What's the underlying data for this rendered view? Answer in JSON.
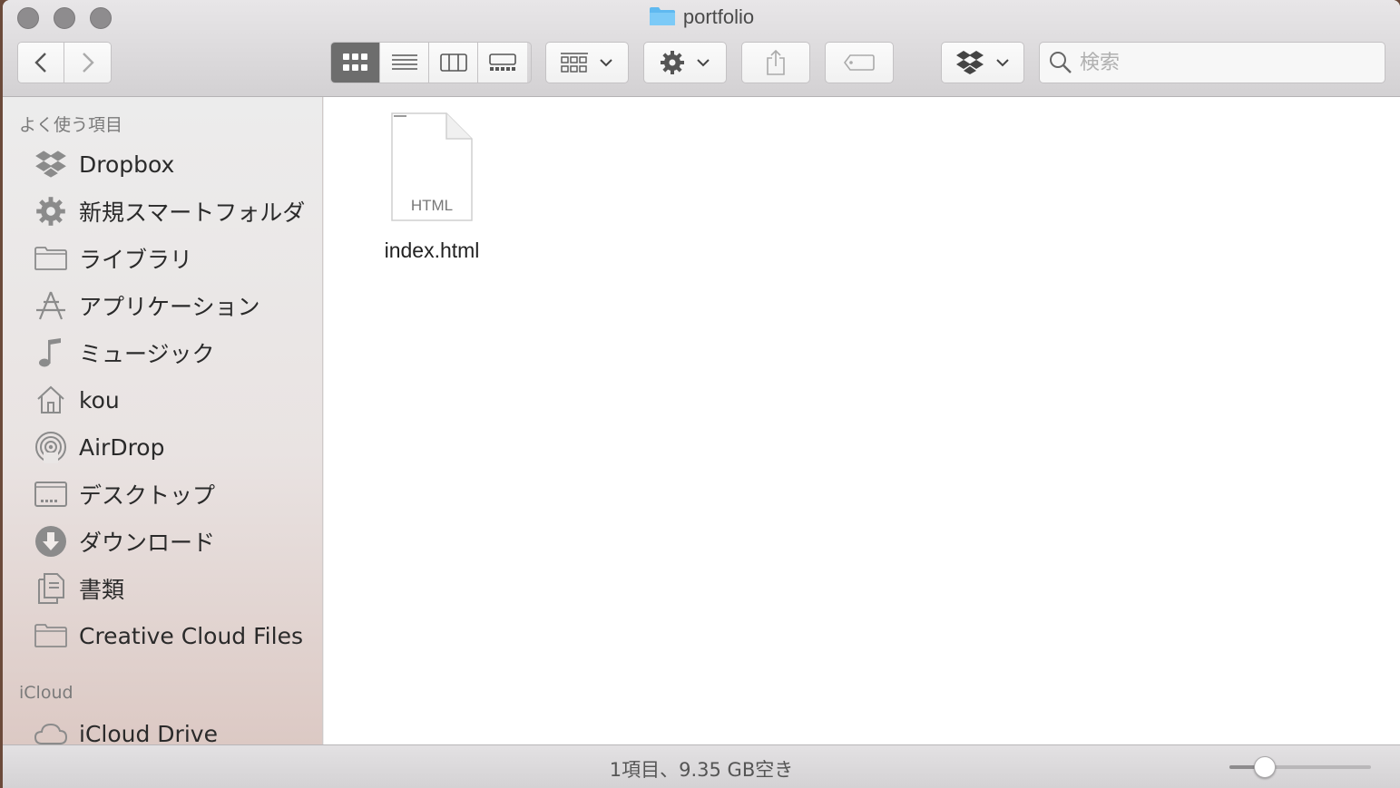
{
  "window": {
    "title": "portfolio"
  },
  "toolbar": {
    "search_placeholder": "検索"
  },
  "sidebar": {
    "favorites_heading": "よく使う項目",
    "items": [
      {
        "label": "Dropbox",
        "icon": "dropbox-icon"
      },
      {
        "label": "新規スマートフォルダ",
        "icon": "gear-icon"
      },
      {
        "label": "ライブラリ",
        "icon": "folder-icon"
      },
      {
        "label": "アプリケーション",
        "icon": "applications-icon"
      },
      {
        "label": "ミュージック",
        "icon": "music-icon"
      },
      {
        "label": "kou",
        "icon": "home-icon"
      },
      {
        "label": "AirDrop",
        "icon": "airdrop-icon"
      },
      {
        "label": "デスクトップ",
        "icon": "desktop-icon"
      },
      {
        "label": "ダウンロード",
        "icon": "download-icon"
      },
      {
        "label": "書類",
        "icon": "documents-icon"
      },
      {
        "label": "Creative Cloud Files",
        "icon": "folder-icon"
      }
    ],
    "icloud_heading": "iCloud",
    "icloud_items": [
      {
        "label": "iCloud Drive",
        "icon": "cloud-icon"
      }
    ]
  },
  "files": [
    {
      "name": "index.html",
      "type_label": "HTML"
    }
  ],
  "status": {
    "text": "1項目、9.35 GB空き",
    "icon_size_fraction": 0.25
  }
}
